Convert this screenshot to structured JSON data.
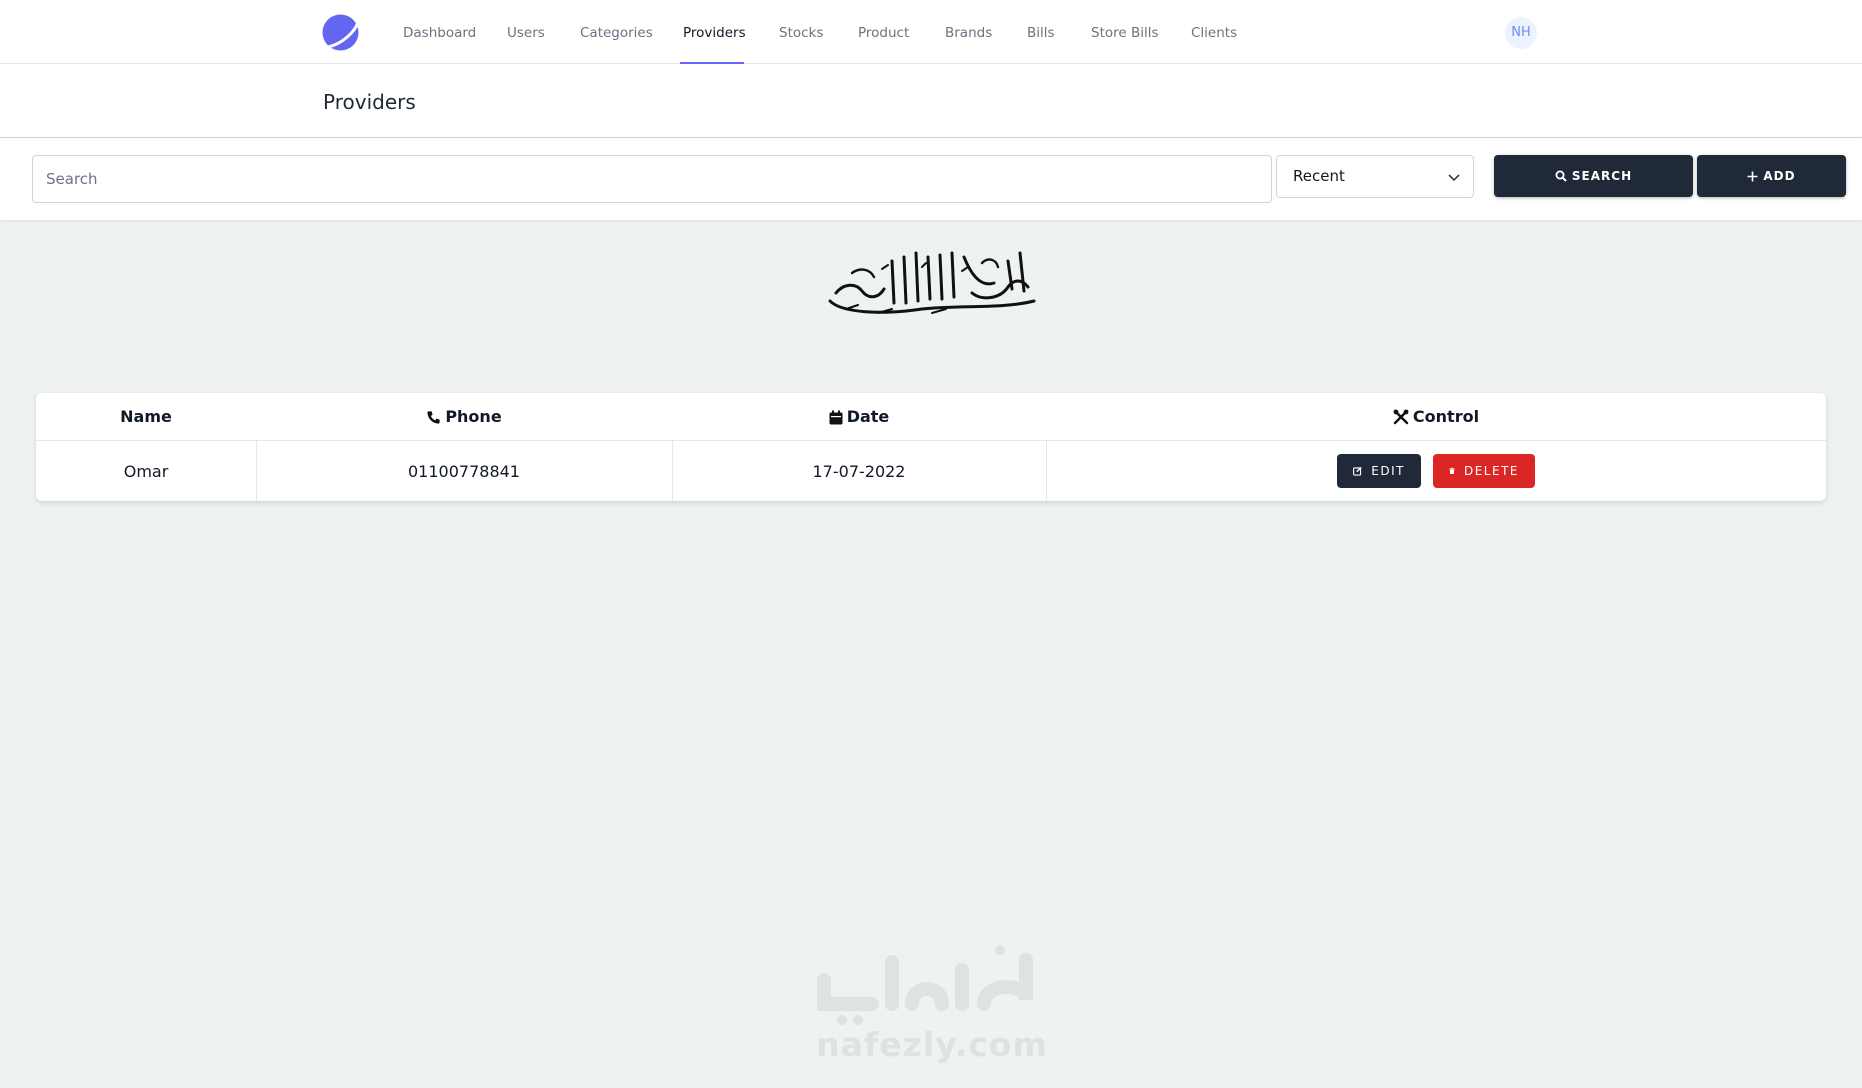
{
  "nav": {
    "items": [
      {
        "label": "Dashboard",
        "active": false
      },
      {
        "label": "Users",
        "active": false
      },
      {
        "label": "Categories",
        "active": false
      },
      {
        "label": "Providers",
        "active": true
      },
      {
        "label": "Stocks",
        "active": false
      },
      {
        "label": "Product",
        "active": false
      },
      {
        "label": "Brands",
        "active": false
      },
      {
        "label": "Bills",
        "active": false
      },
      {
        "label": "Store Bills",
        "active": false
      },
      {
        "label": "Clients",
        "active": false
      }
    ],
    "avatar_initials": "NH",
    "accent_color": "#6366f1"
  },
  "header": {
    "title": "Providers"
  },
  "toolbar": {
    "search_placeholder": "Search",
    "search_value": "",
    "sort_selected": "Recent",
    "search_button": "SEARCH",
    "add_button": "ADD"
  },
  "table": {
    "columns": [
      {
        "label": "Name",
        "icon": ""
      },
      {
        "label": "Phone",
        "icon": "phone-icon"
      },
      {
        "label": "Date",
        "icon": "calendar-icon"
      },
      {
        "label": "Control",
        "icon": "tools-icon"
      }
    ],
    "rows": [
      {
        "name": "Omar",
        "phone": "01100778841",
        "date": "17-07-2022"
      }
    ],
    "edit_label": "EDIT",
    "delete_label": "DELETE"
  },
  "colors": {
    "dark_button": "#1f2937",
    "delete_button": "#dc2626",
    "background": "#eff2f2"
  },
  "watermark": {
    "arabic": "نفذلي",
    "text": "nafezly.com"
  }
}
